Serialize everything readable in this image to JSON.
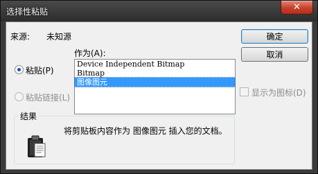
{
  "window": {
    "title": "选择性粘贴",
    "close_label": "✕"
  },
  "source": {
    "label": "来源:",
    "value": "未知源"
  },
  "as_label": "作为(A):",
  "options": {
    "paste_label": "粘贴(P)",
    "paste_selected": true,
    "paste_link_label": "粘贴链接(L)",
    "paste_link_enabled": false
  },
  "format_list": {
    "items": [
      {
        "label": "Device Independent Bitmap",
        "selected": false
      },
      {
        "label": "Bitmap",
        "selected": false
      },
      {
        "label": "图像图元",
        "selected": true
      }
    ]
  },
  "buttons": {
    "ok_label": "确定",
    "cancel_label": "取消"
  },
  "display_as_icon": {
    "label": "显示为图标(D)",
    "checked": false,
    "enabled": false
  },
  "result": {
    "title": "结果",
    "text": "将剪贴板内容作为 图像图元 插入您的文档。",
    "icon": "clipboard-icon"
  },
  "colors": {
    "selection": "#3399ff",
    "close_button": "#c8402a",
    "titlebar": "#3b3b3b"
  }
}
